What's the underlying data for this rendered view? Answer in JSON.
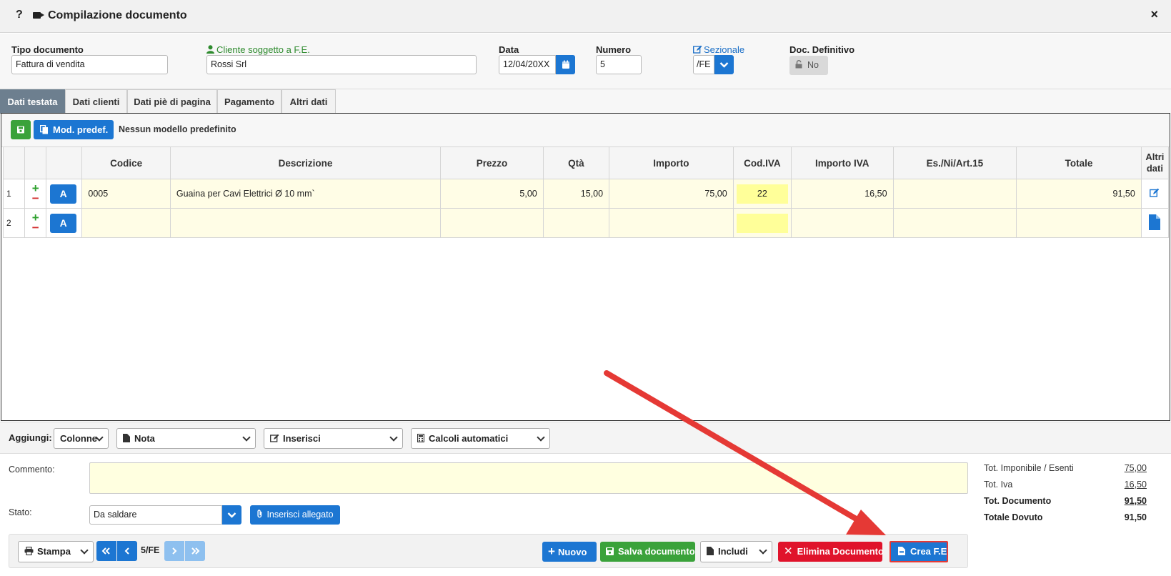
{
  "window": {
    "help": "?",
    "title": "Compilazione documento",
    "close": "×"
  },
  "header": {
    "tipo_label": "Tipo documento",
    "tipo_value": "Fattura di vendita",
    "cliente_label": "Cliente soggetto a F.E.",
    "cliente_value": "Rossi Srl",
    "data_label": "Data",
    "data_value": "12/04/20XX",
    "numero_label": "Numero",
    "numero_value": "5",
    "sezionale_label": "Sezionale",
    "sezionale_value": "/FE",
    "definitivo_label": "Doc. Definitivo",
    "definitivo_value": "No"
  },
  "tabs": [
    "Dati testata",
    "Dati clienti",
    "Dati piè di pagina",
    "Pagamento",
    "Altri dati"
  ],
  "toolbar": {
    "mod_label": "Mod. predef.",
    "nessun_label": "Nessun modello predefinito"
  },
  "grid": {
    "columns": [
      "Codice",
      "Descrizione",
      "Prezzo",
      "Qtà",
      "Importo",
      "Cod.IVA",
      "Importo IVA",
      "Es./Ni/Art.15",
      "Totale",
      "Altri dati"
    ],
    "rows": [
      {
        "n": "1",
        "a": "A",
        "codice": "0005",
        "descrizione": "Guaina per Cavi Elettrici Ø 10 mm`",
        "prezzo": "5,00",
        "qta": "15,00",
        "importo": "75,00",
        "iva": "22",
        "importo_iva": "16,50",
        "es": "",
        "totale": "91,50"
      },
      {
        "n": "2",
        "a": "A",
        "codice": "",
        "descrizione": "",
        "prezzo": "",
        "qta": "",
        "importo": "",
        "iva": "",
        "importo_iva": "",
        "es": "",
        "totale": ""
      }
    ]
  },
  "aggiungi": {
    "label": "Aggiungi:",
    "colonne": "Colonne",
    "nota": "Nota",
    "inserisci": "Inserisci",
    "calcoli": "Calcoli automatici"
  },
  "footer": {
    "commento_label": "Commento:",
    "stato_label": "Stato:",
    "stato_value": "Da saldare",
    "allegato_label": "Inserisci allegato"
  },
  "totals": {
    "imponibile_label": "Tot. Imponibile / Esenti",
    "imponibile_value": "75,00",
    "iva_label": "Tot. Iva",
    "iva_value": "16,50",
    "documento_label": "Tot. Documento",
    "documento_value": "91,50",
    "dovuto_label": "Totale Dovuto",
    "dovuto_value": "91,50"
  },
  "bottom": {
    "stampa": "Stampa",
    "doc_ref": "5/FE",
    "nuovo": "Nuovo",
    "salva": "Salva documento",
    "includi": "Includi",
    "elimina": "Elimina Documento",
    "crea": "Crea F.E"
  },
  "colors": {
    "primary": "#1c76d2",
    "success": "#3aa23a",
    "danger": "#e0132b",
    "annotation_arrow": "#e53935",
    "row_highlight": "#fffde6",
    "iva_highlight": "#ffff99"
  }
}
